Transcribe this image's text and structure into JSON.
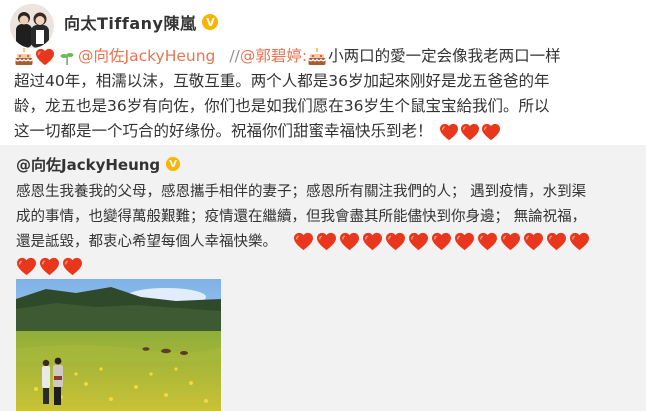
{
  "post": {
    "author": "向太Tiffany陳嵐",
    "icons": [
      "avatar-photo",
      "verified-badge",
      "heart-emoji",
      "cake-emoji",
      "sprout-emoji"
    ],
    "mention_1": "@向佐JackyHeung",
    "separator": "//",
    "mention_2": "@郭碧婷",
    "colon": ":",
    "line1_text": "小两口的愛一定会像我老两口一样",
    "line2": "超过40年，相濡以沫，互敬互重。两个人都是36岁加起來刚好是龙五爸爸的年",
    "line3": "龄，龙五也是36岁有向佐，你们也是如我们愿在36岁生个鼠宝宝給我们。所以",
    "line4": "这一切都是一个巧合的好缘份。祝福你们甜蜜幸福快乐到老！"
  },
  "repost": {
    "author": "@向佐JackyHeung",
    "line1": "感恩生我養我的父母，感恩攜手相伴的妻子；感恩所有關注我們的人；  遇到疫情，水到渠",
    "line2": "成的事情，也變得萬般艱難；疫情還在繼續，但我會盡其所能儘快到你身邊；  無論祝福，",
    "line3": "還是詆毀，都衷心希望每個人幸福快樂。",
    "image": "couple-in-meadow-photo"
  },
  "colors": {
    "mention": "#eb7350",
    "text": "#333333",
    "repost_bg": "#f2f2f2",
    "verified": "#f7b500",
    "heart": "#e8371d"
  }
}
